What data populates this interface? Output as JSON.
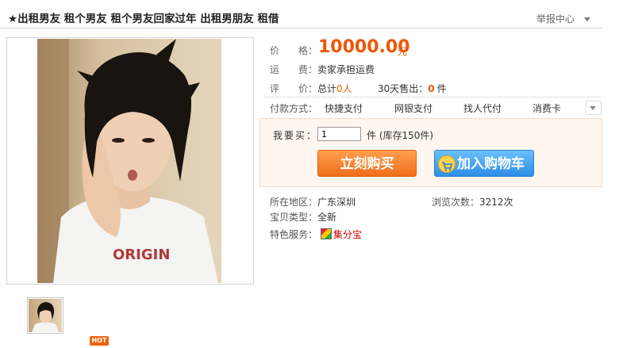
{
  "header": {
    "title": "★出租男友 租个男友 租个男友回家过年 出租男朋友 租借",
    "report": "举报中心"
  },
  "item": {
    "price_label": "价　　格：",
    "price": "10000.00",
    "price_unit": "元",
    "shipping_label": "运　　费：",
    "shipping": "卖家承担运费",
    "review_label": "评　　价：",
    "review_prefix": "总计",
    "review_count": "0人",
    "sold_label": "30天售出：",
    "sold_count": "0",
    "sold_unit": "件"
  },
  "payment": {
    "label": "付款方式：",
    "methods": [
      "快捷支付",
      "网银支付",
      "找人代付",
      "消费卡"
    ]
  },
  "buy": {
    "qty_label": "我要买：",
    "qty_value": "1",
    "stock": "件 (库存150件)",
    "buy_now": "立刻购买",
    "add_cart": "加入购物车"
  },
  "details": {
    "location_label": "所在地区：",
    "location": "广东深圳",
    "views_label": "浏览次数：",
    "views": "3212次",
    "type_label": "宝贝类型：",
    "type": "全新",
    "service_label": "特色服务：",
    "service": "集分宝"
  },
  "gallery": {
    "shirt_text": "ORIGIN",
    "hot_badge": "HOT"
  }
}
